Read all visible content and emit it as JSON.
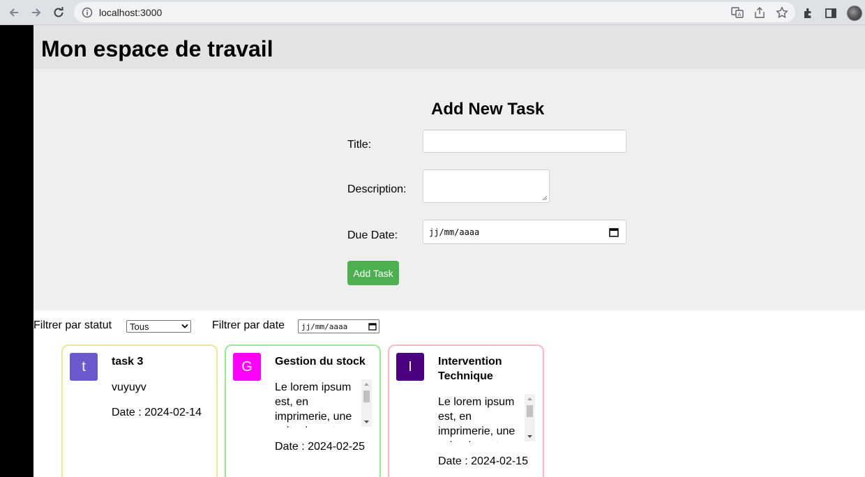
{
  "browser": {
    "url": "localhost:3000"
  },
  "page": {
    "title": "Mon espace de travail"
  },
  "form": {
    "heading": "Add New Task",
    "title_label": "Title:",
    "title_value": "",
    "description_label": "Description:",
    "description_value": "",
    "due_date_label": "Due Date:",
    "due_date_placeholder": "jj/mm/aaaa",
    "submit_label": "Add Task"
  },
  "filters": {
    "status_label": "Filtrer par statut",
    "status_selected": "Tous",
    "date_label": "Filtrer par date",
    "date_placeholder": "jj/mm/aaaa"
  },
  "cards": [
    {
      "initial": "t",
      "badge_color": "#6a5acd",
      "border_color": "#f0e68c",
      "title": "task 3",
      "description": "vuyuyv",
      "date": "Date : 2024-02-14"
    },
    {
      "initial": "G",
      "badge_color": "#ff00ff",
      "border_color": "#90ee90",
      "title": "Gestion du stock",
      "description": "Le lorem ipsum est, en imprimerie, une suite de mots",
      "date": "Date : 2024-02-25"
    },
    {
      "initial": "I",
      "badge_color": "#4b0082",
      "border_color": "#ffb6c1",
      "title": "Intervention Technique",
      "description": "Le lorem ipsum est, en imprimerie, une suite de mots",
      "date": "Date : 2024-02-15"
    }
  ],
  "colors": {
    "accent_green": "#4caf50",
    "header_bg": "#e3e3e3",
    "form_bg": "#efefef"
  }
}
